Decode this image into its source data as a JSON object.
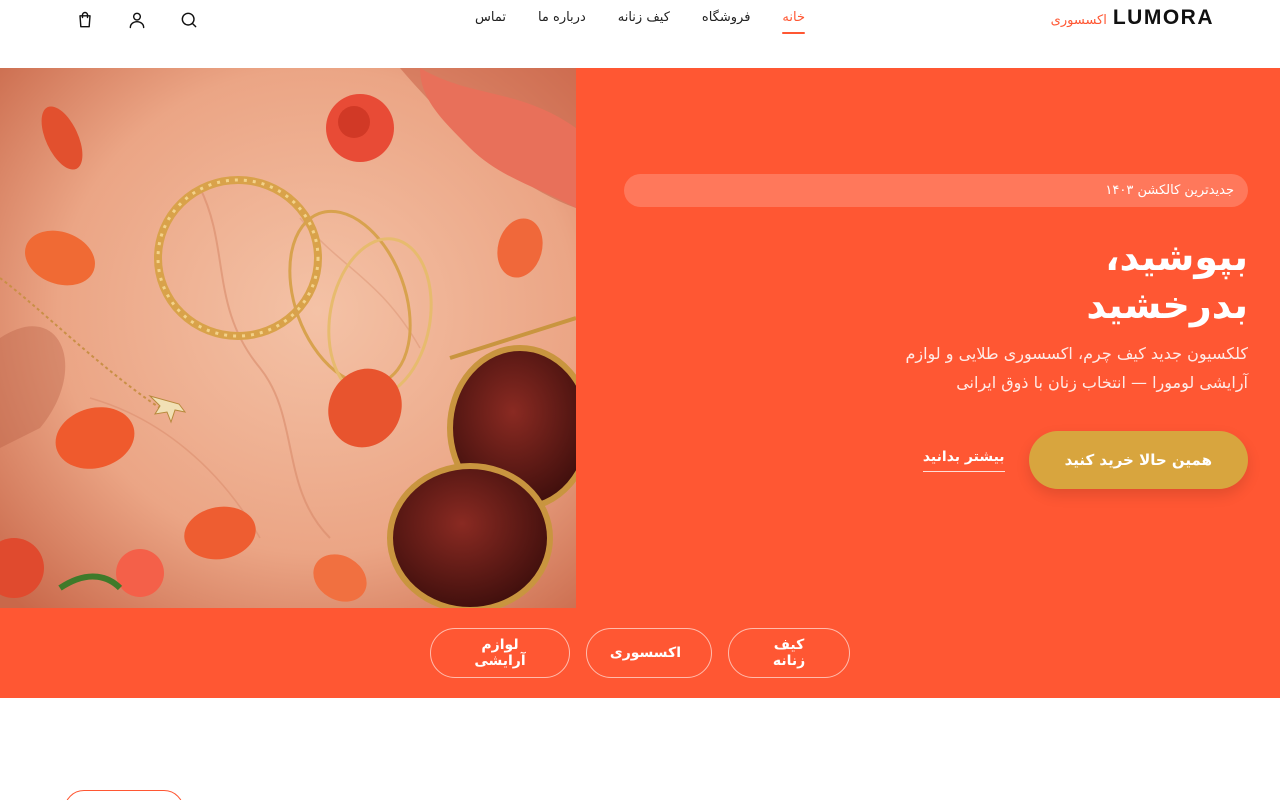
{
  "brand": {
    "name": "LUMORA",
    "subtitle": "اکسسوری"
  },
  "nav": {
    "items": [
      "خانه",
      "فروشگاه",
      "کیف زنانه",
      "درباره ما",
      "تماس"
    ],
    "active": "خانه"
  },
  "header_icons": [
    "search-icon",
    "user-icon",
    "cart-icon"
  ],
  "hero": {
    "badge": "جدیدترین کالکشن ۱۴۰۳",
    "title_line1": "بپوشید،",
    "title_line2": "بدرخشید",
    "description": "کلکسیون جدید کیف چرم، اکسسوری طلایی و لوازم آرایشی لومورا — انتخاب زنان با ذوق ایرانی",
    "primary_cta": "همین حالا خرید کنید",
    "secondary_cta": "بیشتر بدانید",
    "image_alt": "جواهرات طلایی، عینک آفتابی و گلبرگ‌های رز روی سنگ مرمر"
  },
  "categories": [
    "کیف زنانه",
    "اکسسوری",
    "لوازم آرایشی"
  ],
  "colors": {
    "accent": "#ff5733",
    "gold": "#d8a53e",
    "text": "#111111"
  }
}
